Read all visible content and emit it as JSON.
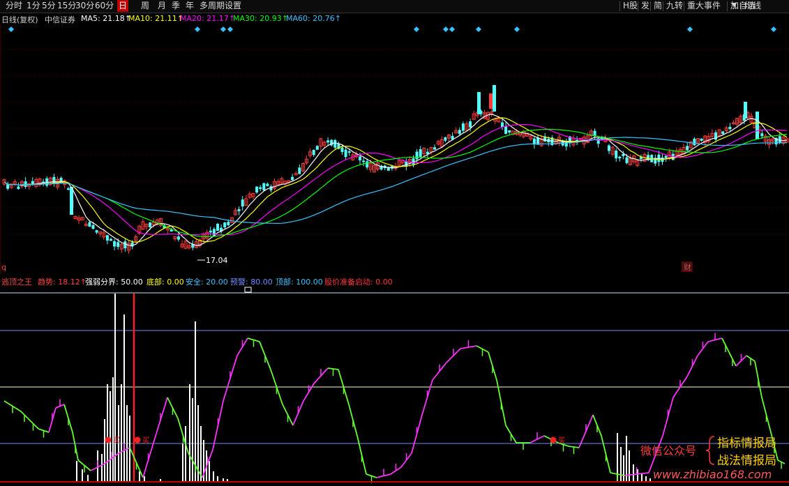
{
  "toolbar": {
    "left_tabs": [
      "分时",
      "1分",
      "5分",
      "15分",
      "30分",
      "60分",
      "日",
      "周",
      "月",
      "季",
      "年",
      "多周期",
      "设置"
    ],
    "active_tab": "日",
    "right_tabs": [
      "H股",
      "发",
      "简",
      "九转",
      "重大事件",
      "加自选",
      "均线"
    ]
  },
  "info": {
    "period": "日线(复权)",
    "name": "中信证券",
    "ma5": "MA5: 21.18↑",
    "ma10": "MA10: 21.11↑",
    "ma20": "MA20: 21.17↑",
    "ma30": "MA30: 20.93↑",
    "ma60": "MA60: 20.76↑"
  },
  "price_annotation": "17.04",
  "badge_q": "q",
  "badge_cai": "财",
  "indicator": {
    "name": "逃顶之王",
    "trend": "趋势: 18.12↑",
    "threshold": "强弱分界: 50.00",
    "bottom": "底部: 0.00",
    "safe": "安全: 20.00",
    "warn": "预警: 80.00",
    "top": "顶部: 100.00",
    "alert": "股价准备启动: 0.00"
  },
  "buy_label": "买",
  "watermark": {
    "wechat": "微信公众号",
    "line1": "指标情报局",
    "line2": "战法情报局",
    "url": "www.zhibiao168.com"
  },
  "colors": {
    "ma5": "#ffffff",
    "ma10": "#ffff00",
    "ma20": "#ff00ff",
    "ma30": "#00ff00",
    "ma60": "#39c3ff",
    "up": "#ff3b3b",
    "down": "#54ffff",
    "accent": "#c00000"
  }
}
